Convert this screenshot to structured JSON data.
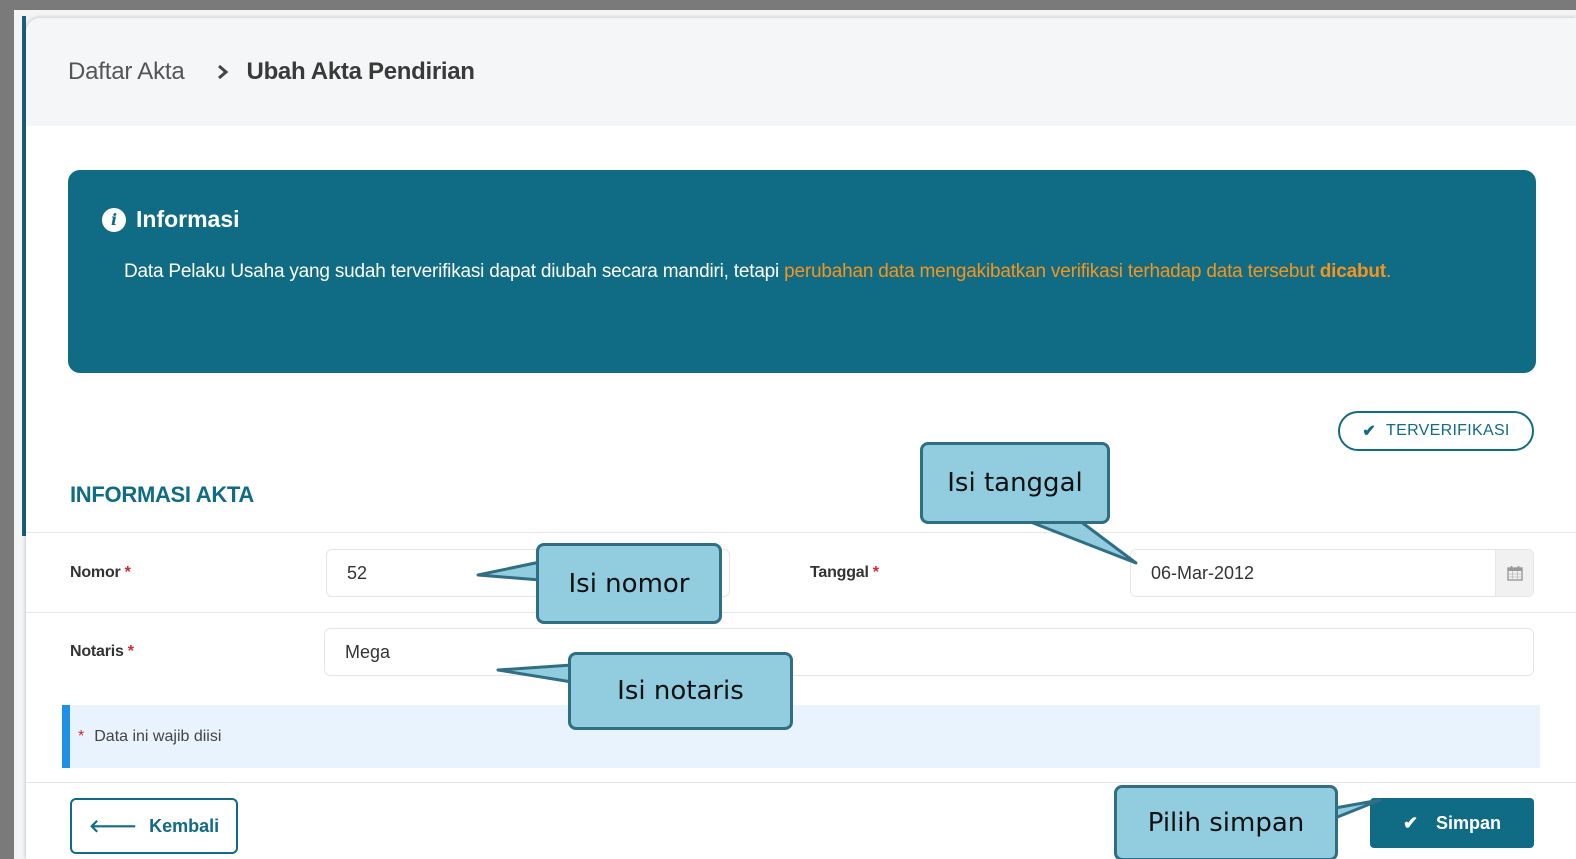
{
  "breadcrumb": {
    "parent": "Daftar Akta",
    "current": "Ubah Akta Pendirian"
  },
  "info": {
    "title": "Informasi",
    "text_normal": "Data Pelaku Usaha yang sudah terverifikasi dapat diubah secara mandiri, tetapi ",
    "text_warning": "perubahan data mengakibatkan verifikasi terhadap data tersebut ",
    "text_warning_bold": "dicabut",
    "text_end": "."
  },
  "status": {
    "label": "TERVERIFIKASI"
  },
  "section": {
    "title": "INFORMASI AKTA"
  },
  "form": {
    "nomor_label": "Nomor",
    "nomor_value": "52",
    "tanggal_label": "Tanggal",
    "tanggal_value": "06-Mar-2012",
    "notaris_label": "Notaris",
    "notaris_value": "Mega",
    "required_star": "*",
    "required_note": "Data ini wajib diisi"
  },
  "actions": {
    "back_label": "Kembali",
    "save_label": "Simpan"
  },
  "callouts": {
    "nomor": "Isi nomor",
    "tanggal": "Isi tanggal",
    "notaris": "Isi notaris",
    "simpan": "Pilih simpan"
  },
  "colors": {
    "primary": "#106b85",
    "warning": "#f7941d",
    "required": "#d9232e",
    "note_border": "#1e90e6",
    "callout_fill": "#92cddf",
    "callout_border": "#2f6e83"
  },
  "icons": {
    "breadcrumb_separator": "chevron-right-icon",
    "info": "info-circle-icon",
    "verified": "check-icon",
    "calendar": "calendar-icon",
    "back": "arrow-left-icon",
    "save": "check-icon"
  }
}
